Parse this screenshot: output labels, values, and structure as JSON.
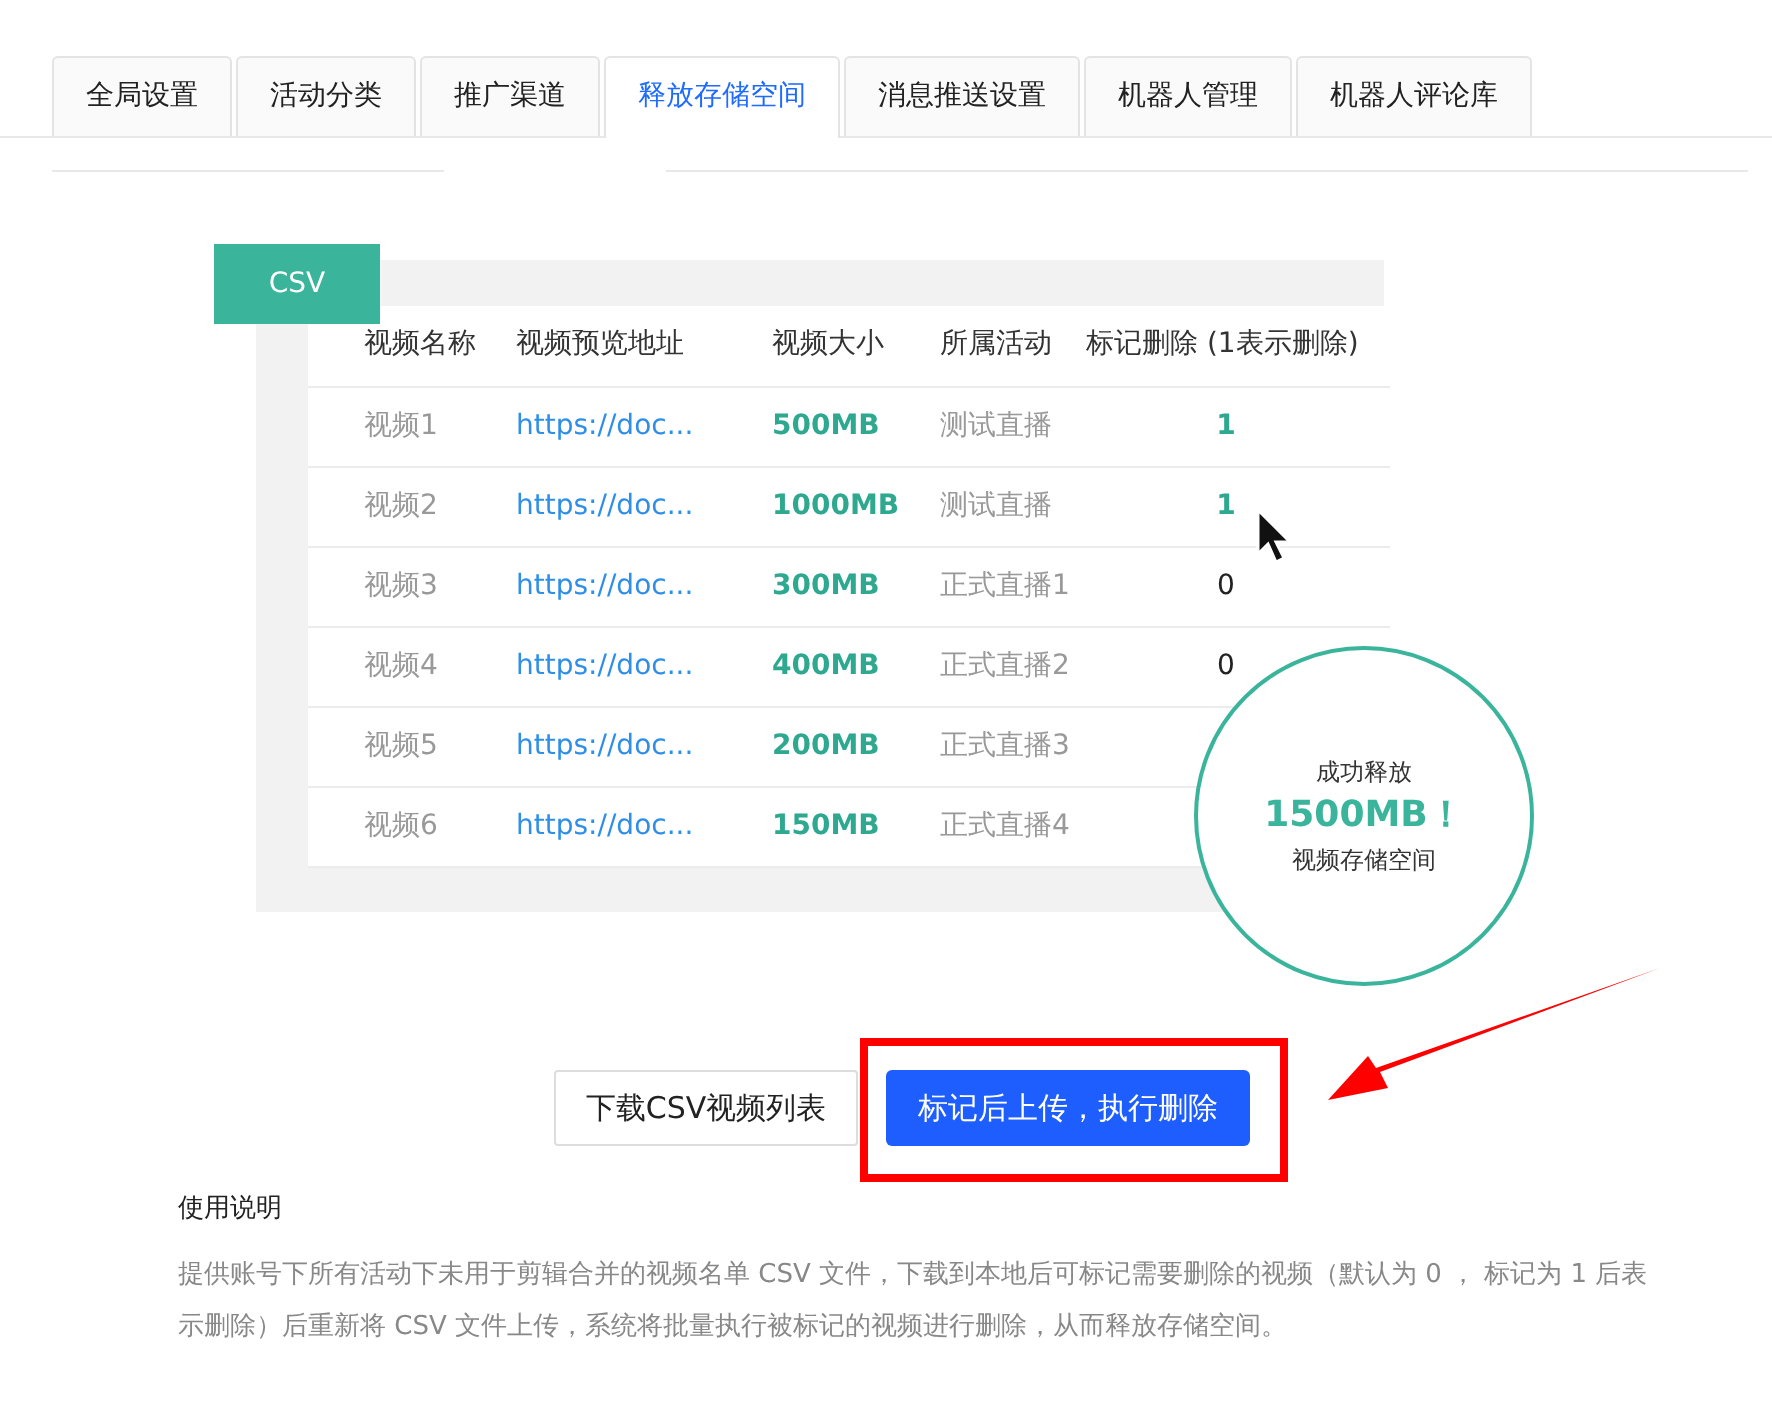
{
  "tabs": [
    {
      "label": "全局设置",
      "selected": false
    },
    {
      "label": "活动分类",
      "selected": false
    },
    {
      "label": "推广渠道",
      "selected": false
    },
    {
      "label": "释放存储空间",
      "selected": true
    },
    {
      "label": "消息推送设置",
      "selected": false
    },
    {
      "label": "机器人管理",
      "selected": false
    },
    {
      "label": "机器人评论库",
      "selected": false
    }
  ],
  "illustration": {
    "badge": "CSV",
    "table": {
      "columns": [
        "视频名称",
        "视频预览地址",
        "视频大小",
        "所属活动",
        "标记删除 (1表示删除)"
      ],
      "rows": [
        {
          "name": "视频1",
          "url": "https://doc...",
          "size": "500MB",
          "activity": "测试直播",
          "mark": "1",
          "marked": true
        },
        {
          "name": "视频2",
          "url": "https://doc...",
          "size": "1000MB",
          "activity": "测试直播",
          "mark": "1",
          "marked": true
        },
        {
          "name": "视频3",
          "url": "https://doc...",
          "size": "300MB",
          "activity": "正式直播1",
          "mark": "0",
          "marked": false
        },
        {
          "name": "视频4",
          "url": "https://doc...",
          "size": "400MB",
          "activity": "正式直播2",
          "mark": "0",
          "marked": false
        },
        {
          "name": "视频5",
          "url": "https://doc...",
          "size": "200MB",
          "activity": "正式直播3"
        },
        {
          "name": "视频6",
          "url": "https://doc...",
          "size": "150MB",
          "activity": "正式直播4"
        }
      ]
    },
    "result": {
      "line_1": "成功释放",
      "amount": "1500MB！",
      "line_3": "视频存储空间"
    }
  },
  "buttons": [
    {
      "label": "下载CSV视频列表",
      "kind": "secondary"
    },
    {
      "label": "标记后上传，执行删除",
      "kind": "primary",
      "highlighted": true
    }
  ],
  "instructions": {
    "title": "使用说明",
    "text": "提供账号下所有活动下未用于剪辑合并的视频名单 CSV 文件，下载到本地后可标记需要删除的视频（默认为 0 ， 标记为 1 后表示删除）后重新将 CSV 文件上传，系统将批量执行被标记的视频进行删除，从而释放存储空间。"
  }
}
